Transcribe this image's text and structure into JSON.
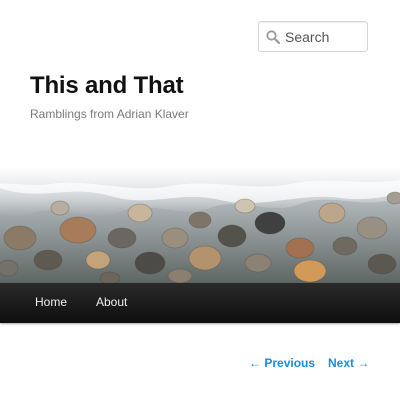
{
  "header": {
    "site_title": "This and That",
    "site_description": "Ramblings from Adrian Klaver",
    "header_image_alt": "Pebbles at the water's edge"
  },
  "search": {
    "placeholder": "Search",
    "icon": "search-icon"
  },
  "nav": {
    "items": [
      {
        "label": "Home"
      },
      {
        "label": "About"
      }
    ]
  },
  "post_nav": {
    "previous_arrow": "←",
    "previous_label": "Previous",
    "next_label": "Next",
    "next_arrow": "→"
  },
  "colors": {
    "link": "#1b8be0",
    "nav_bar": "#1a1a1a",
    "title": "#111111"
  }
}
